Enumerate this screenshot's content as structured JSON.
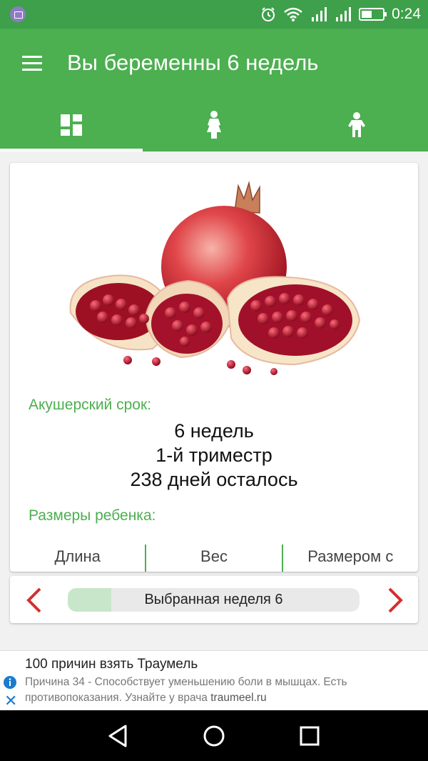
{
  "status_bar": {
    "time": "0:24",
    "icons": [
      "app-notification-icon",
      "alarm-icon",
      "wifi-icon",
      "signal-icon",
      "signal-icon",
      "battery-icon"
    ]
  },
  "app_bar": {
    "title": "Вы беременны 6 недель",
    "tabs": [
      {
        "icon": "dashboard-icon",
        "active": true
      },
      {
        "icon": "mother-icon",
        "active": false
      },
      {
        "icon": "baby-icon",
        "active": false
      }
    ]
  },
  "card": {
    "image": "pomegranate",
    "obstetric_label": "Акушерский срок:",
    "weeks_text": "6 недель",
    "trimester_text": "1-й триместр",
    "days_left_text": "238 дней осталось",
    "baby_size_label": "Размеры ребенка:",
    "size_columns": [
      "Длина",
      "Вес",
      "Размером с"
    ]
  },
  "week_selector": {
    "label": "Выбранная неделя 6",
    "progress": 0.15
  },
  "ad": {
    "title": "100 причин взять Траумель",
    "text": "Причина 34 - Способствует уменьшению боли в мышцах. Есть противопоказания. Узнайте у врача ",
    "link": "traumeel.ru"
  },
  "colors": {
    "primary": "#4caf50",
    "status_bar": "#3ea04a",
    "arrow": "#d32f2f",
    "week_fill": "#c8e6c9"
  }
}
